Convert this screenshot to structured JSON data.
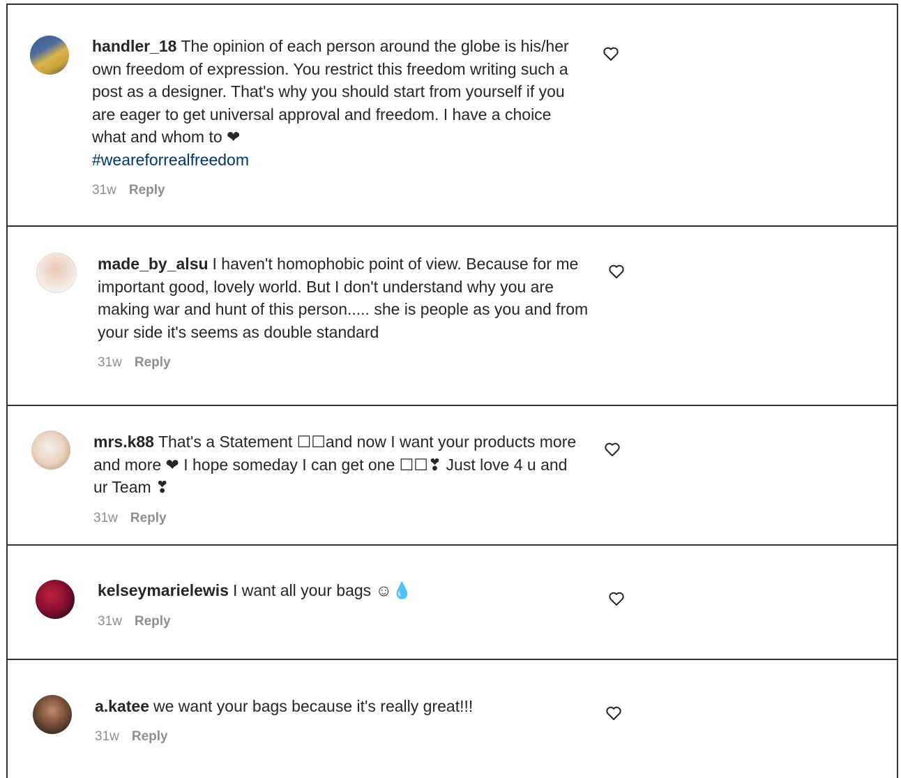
{
  "comments": [
    {
      "username": "handler_18",
      "text": "The opinion of each person around the globe is his/her own freedom of expression. You restrict this freedom writing such a post as a designer. That's why you should start from yourself if you are eager to get universal approval and freedom. I have a choice what and whom to ❤",
      "hashtag": "#weareforrealfreedom",
      "age": "31w",
      "reply": "Reply"
    },
    {
      "username": "made_by_alsu",
      "text": "I haven't homophobic point of view. Because for me important good, lovely world. But I don't understand why you are making war and hunt of this person..... she is people as you and from your side it's seems as double standard",
      "age": "31w",
      "reply": "Reply"
    },
    {
      "username": "mrs.k88",
      "text": "That's a Statement ☐☐and now I want your products more and more ❤ I hope someday I can get one ☐☐❣ Just love 4 u and ur Team ❣",
      "age": "31w",
      "reply": "Reply"
    },
    {
      "username": "kelseymarielewis",
      "text": "I want all your bags ☺💧",
      "age": "31w",
      "reply": "Reply"
    },
    {
      "username": "a.katee",
      "text": "we want your bags because it's really great!!!",
      "age": "31w",
      "reply": "Reply"
    }
  ],
  "icons": {
    "like": "heart-outline-icon"
  }
}
